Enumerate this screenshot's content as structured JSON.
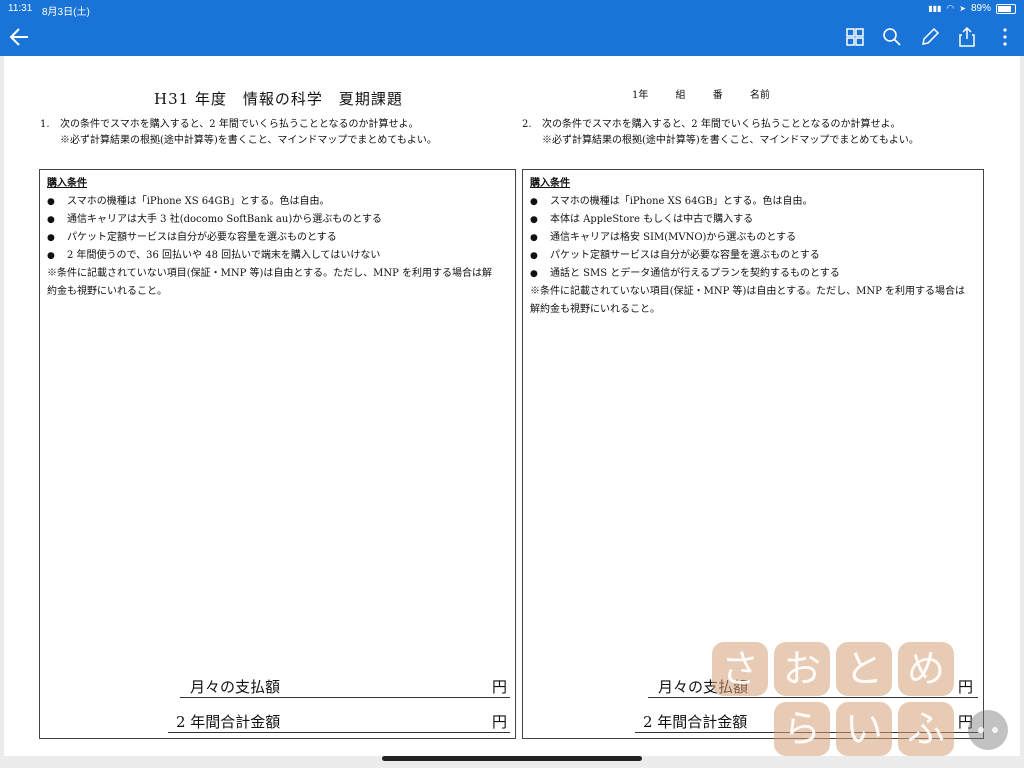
{
  "status_bar": {
    "time": "11:31",
    "date": "8月3日(土)",
    "battery": "89%"
  },
  "app_bar": {
    "back_icon": "arrow-left",
    "tools": [
      "grid-view",
      "search",
      "pencil",
      "share",
      "more-vertical"
    ]
  },
  "document": {
    "title": "H31 年度　情報の科学　夏期課題",
    "student_fields": "1年 組 番 名前",
    "q1": {
      "num": "1.",
      "text": "次の条件でスマホを購入すると、2 年間でいくら払うこととなるのか計算せよ。",
      "note": "※必ず計算結果の根拠(途中計算等)を書くこと、マインドマップでまとめてもよい。",
      "heading": "購入条件",
      "items": [
        "スマホの機種は「iPhone XS 64GB」とする。色は自由。",
        "通信キャリアは大手 3 社(docomo SoftBank au)から選ぶものとする",
        "パケット定額サービスは自分が必要な容量を選ぶものとする",
        "2 年間使うので、36 回払いや 48 回払いで端末を購入してはいけない"
      ],
      "remark_lines": [
        "※条件に記載されていない項目(保証・MNP 等)は自由とする。ただし、MNP を利用する場合は解",
        "約金も視野にいれること。"
      ],
      "monthly_label": "月々の支払額",
      "total_label": "2 年間合計金額",
      "yen": "円"
    },
    "q2": {
      "num": "2.",
      "text": "次の条件でスマホを購入すると、2 年間でいくら払うこととなるのか計算せよ。",
      "note": "※必ず計算結果の根拠(途中計算等)を書くこと、マインドマップでまとめてもよい。",
      "heading": "購入条件",
      "items": [
        "スマホの機種は「iPhone XS 64GB」とする。色は自由。",
        "本体は AppleStore もしくは中古で購入する",
        "通信キャリアは格安 SIM(MVNO)から選ぶものとする",
        "パケット定額サービスは自分が必要な容量を選ぶものとする",
        "通話と SMS とデータ通信が行えるプランを契約するものとする"
      ],
      "remark_lines": [
        "※条件に記載されていない項目(保証・MNP 等)は自由とする。ただし、MNP を利用する場合は",
        "解約金も視野にいれること。"
      ],
      "monthly_label": "月々の支払額",
      "total_label": "2 年間合計金額",
      "yen": "円"
    }
  },
  "watermark": {
    "chars": [
      "さ",
      "お",
      "と",
      "め",
      "ら",
      "い",
      "ふ"
    ]
  },
  "colors": {
    "app_bar": "#1a73d6",
    "watermark": "#d6a078"
  }
}
